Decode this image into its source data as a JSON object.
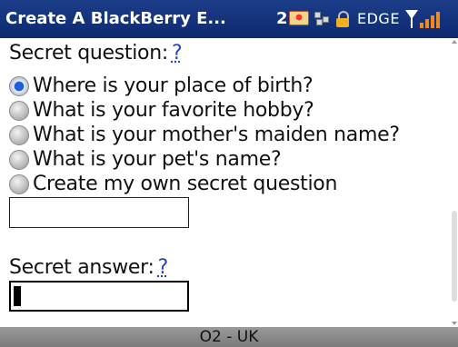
{
  "title_bar": {
    "title": "Create A BlackBerry E...",
    "message_count": "2",
    "network": "EDGE",
    "icons": [
      "envelope-icon",
      "bbm-icon",
      "lock-icon",
      "signal-icon"
    ],
    "signal_strength": 4,
    "signal_max": 4
  },
  "form": {
    "secret_question_label": "Secret question:",
    "help_link": "?",
    "options": [
      {
        "label": "Where is your place of birth?",
        "selected": true
      },
      {
        "label": "What is your favorite hobby?",
        "selected": false
      },
      {
        "label": "What is your mother's maiden name?",
        "selected": false
      },
      {
        "label": "What is your pet's name?",
        "selected": false
      },
      {
        "label": "Create my own secret question",
        "selected": false
      }
    ],
    "custom_question_value": "",
    "secret_answer_label": "Secret answer:",
    "secret_answer_value": ""
  },
  "footer": {
    "carrier": "O2 - UK"
  },
  "colors": {
    "title_bar": "#0d2a6e",
    "link": "#2a44c0",
    "selected_radio": "#1d5fd8",
    "footer": "#8a8a8a"
  }
}
